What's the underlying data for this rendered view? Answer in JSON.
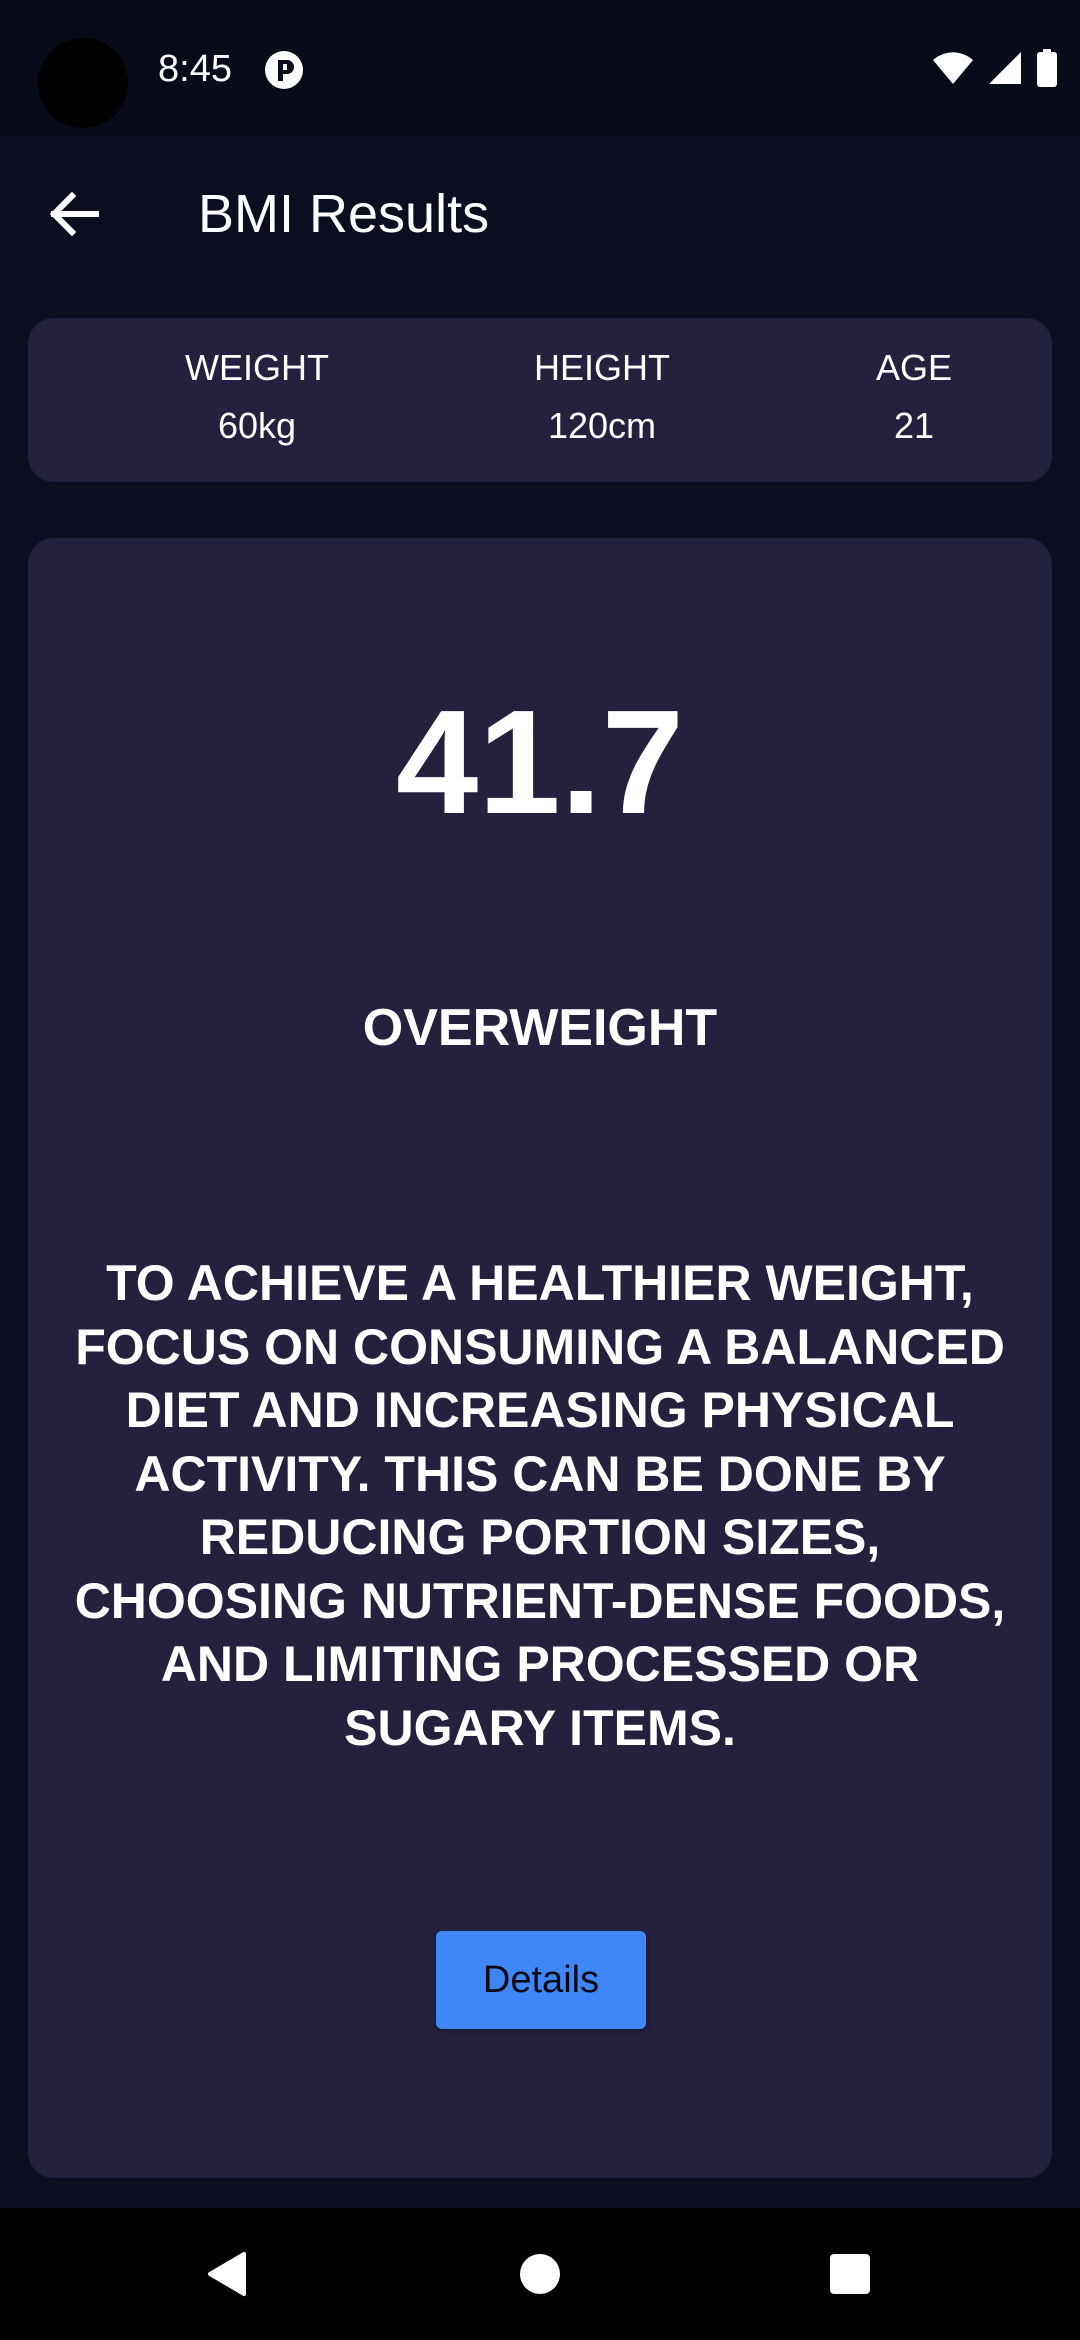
{
  "status_bar": {
    "time": "8:45",
    "icons": [
      "notification-app-icon",
      "wifi-icon",
      "cellular-signal-icon",
      "battery-icon"
    ]
  },
  "app_bar": {
    "title": "BMI Results",
    "back_icon": "arrow-left-icon"
  },
  "stats": {
    "weight_label": "WEIGHT",
    "weight_value": "60kg",
    "height_label": "HEIGHT",
    "height_value": "120cm",
    "age_label": "AGE",
    "age_value": "21"
  },
  "result": {
    "bmi": "41.7",
    "category": "OVERWEIGHT",
    "advice_lines": [
      "TO ACHIEVE A HEALTHIER WEIGHT,",
      "FOCUS ON CONSUMING A BALANCED",
      "DIET AND INCREASING PHYSICAL",
      "ACTIVITY. THIS CAN BE DONE BY",
      "REDUCING PORTION SIZES,",
      "CHOOSING NUTRIENT-DENSE FOODS,",
      "AND LIMITING PROCESSED OR",
      "SUGARY ITEMS."
    ],
    "details_label": "Details"
  },
  "nav_bar": {
    "icons": [
      "back-triangle-icon",
      "home-circle-icon",
      "recents-square-icon"
    ]
  },
  "colors": {
    "background": "#0b0e1f",
    "card": "#24213f",
    "accent": "#3f86f9"
  }
}
